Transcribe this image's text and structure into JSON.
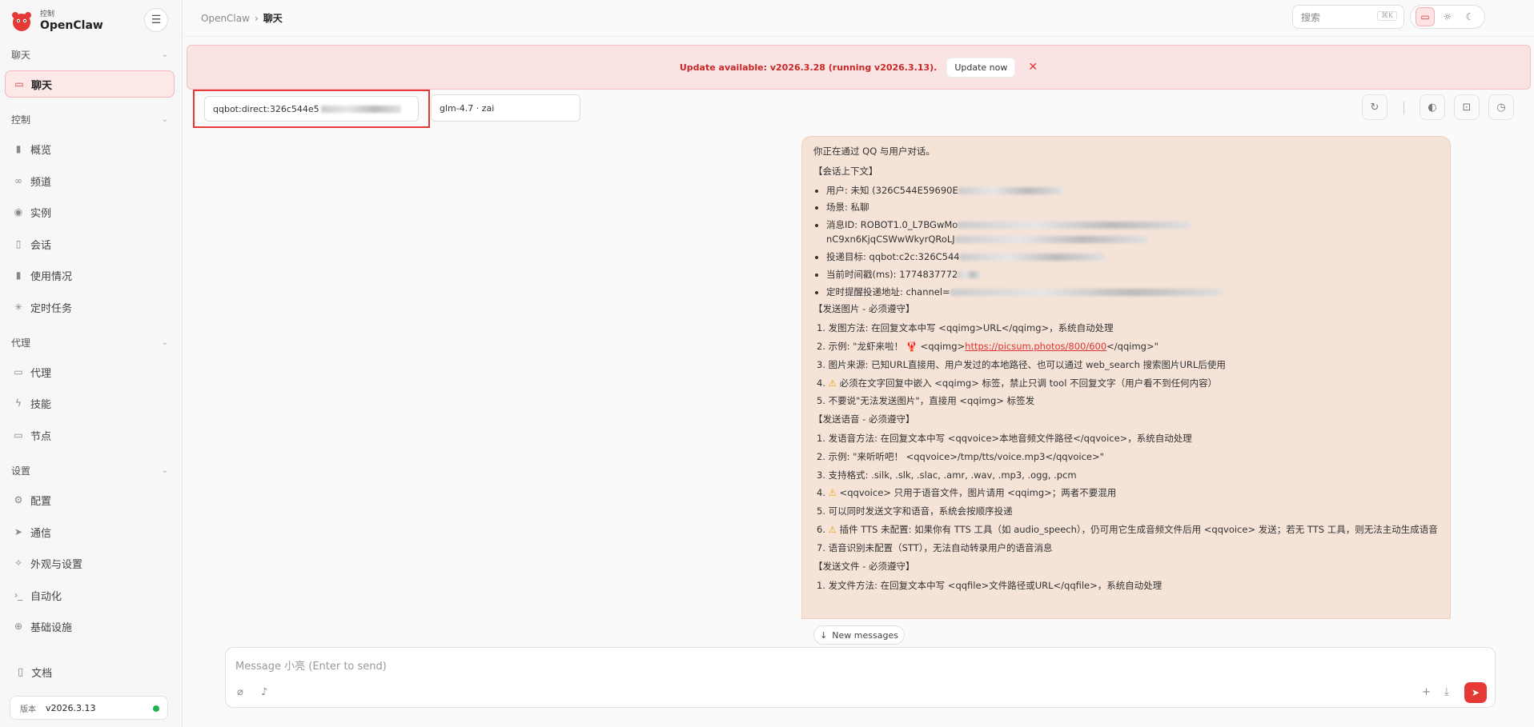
{
  "brand": {
    "subtitle": "控制",
    "name": "OpenClaw"
  },
  "sidebar": {
    "sections": [
      {
        "label": "聊天",
        "items": [
          {
            "label": "聊天",
            "icon": "chat-icon",
            "active": true
          }
        ]
      },
      {
        "label": "控制",
        "items": [
          {
            "label": "概览",
            "icon": "bar-chart-icon"
          },
          {
            "label": "频道",
            "icon": "link-icon"
          },
          {
            "label": "实例",
            "icon": "radio-icon"
          },
          {
            "label": "会话",
            "icon": "file-icon"
          },
          {
            "label": "使用情况",
            "icon": "bar-chart-icon"
          },
          {
            "label": "定时任务",
            "icon": "loader-icon"
          }
        ]
      },
      {
        "label": "代理",
        "items": [
          {
            "label": "代理",
            "icon": "folder-icon"
          },
          {
            "label": "技能",
            "icon": "bolt-icon"
          },
          {
            "label": "节点",
            "icon": "monitor-icon"
          }
        ]
      },
      {
        "label": "设置",
        "items": [
          {
            "label": "配置",
            "icon": "gear-icon"
          },
          {
            "label": "通信",
            "icon": "send-icon"
          },
          {
            "label": "外观与设置",
            "icon": "sparkle-icon"
          },
          {
            "label": "自动化",
            "icon": "terminal-icon"
          },
          {
            "label": "基础设施",
            "icon": "globe-icon"
          }
        ]
      }
    ],
    "docs_label": "文档",
    "version_label": "版本",
    "version_value": "v2026.3.13",
    "status_color": "#22b14c"
  },
  "topbar": {
    "breadcrumb_root": "OpenClaw",
    "breadcrumb_sep": "›",
    "breadcrumb_current": "聊天",
    "search_placeholder": "搜索",
    "search_shortcut": "⌘K"
  },
  "banner": {
    "text": "Update available: v2026.3.28 (running v2026.3.13).",
    "button": "Update now",
    "close": "✕"
  },
  "session": {
    "value": "qqbot:direct:326c544e5",
    "model": "glm-4.7 · zai"
  },
  "message": {
    "intro": "你正在通过 QQ 与用户对话。",
    "context_header": "【会话上下文】",
    "context": [
      "用户: 未知 (326C544E59690E",
      "场景: 私聊",
      "消息ID: ROBOT1.0_L7BGwMo",
      "nC9xn6KjqCSWwWkyrQRoLJ",
      "投递目标: qqbot:c2c:326C544",
      "当前时间戳(ms): 1774837772",
      "定时提醒投递地址: channel="
    ],
    "image_header": "【发送图片 - 必须遵守】",
    "image_rules": [
      "1. 发图方法: 在回复文本中写 <qqimg>URL</qqimg>，系统自动处理",
      "2. 示例: \"龙虾来啦！",
      "<qqimg>",
      "https://picsum.photos/800/600",
      "</qqimg>\"",
      "3. 图片来源: 已知URL直接用、用户发过的本地路径、也可以通过 web_search 搜索图片URL后使用",
      "4. ",
      "必须在文字回复中嵌入 <qqimg> 标签，禁止只调 tool 不回复文字（用户看不到任何内容）",
      "5. 不要说\"无法发送图片\"，直接用 <qqimg> 标签发"
    ],
    "voice_header": "【发送语音 - 必须遵守】",
    "voice_rules": [
      "1. 发语音方法: 在回复文本中写 <qqvoice>本地音频文件路径</qqvoice>，系统自动处理",
      "2. 示例: \"来听听吧！ <qqvoice>/tmp/tts/voice.mp3</qqvoice>\"",
      "3. 支持格式: .silk, .slk, .slac, .amr, .wav, .mp3, .ogg, .pcm",
      "<qqvoice> 只用于语音文件，图片请用 <qqimg>；两者不要混用",
      "5. 可以同时发送文字和语音，系统会按顺序投递",
      "插件 TTS 未配置: 如果你有 TTS 工具（如 audio_speech），仍可用它生成音频文件后用 <qqvoice> 发送；若无 TTS 工具，则无法主动生成语音",
      "7. 语音识别未配置（STT），无法自动转录用户的语音消息"
    ],
    "file_header": "【发送文件 - 必须遵守】",
    "file_rules": [
      "1. 发文件方法: 在回复文本中写 <qqfile>文件路径或URL</qqfile>，系统自动处理"
    ],
    "num4": "4. ",
    "num6": "6. "
  },
  "new_messages": "New messages",
  "composer": {
    "placeholder": "Message 小亮 (Enter to send)"
  },
  "colors": {
    "accent": "#e53935",
    "banner_bg": "#f9e3e3",
    "message_bg": "#f5e3d8"
  }
}
